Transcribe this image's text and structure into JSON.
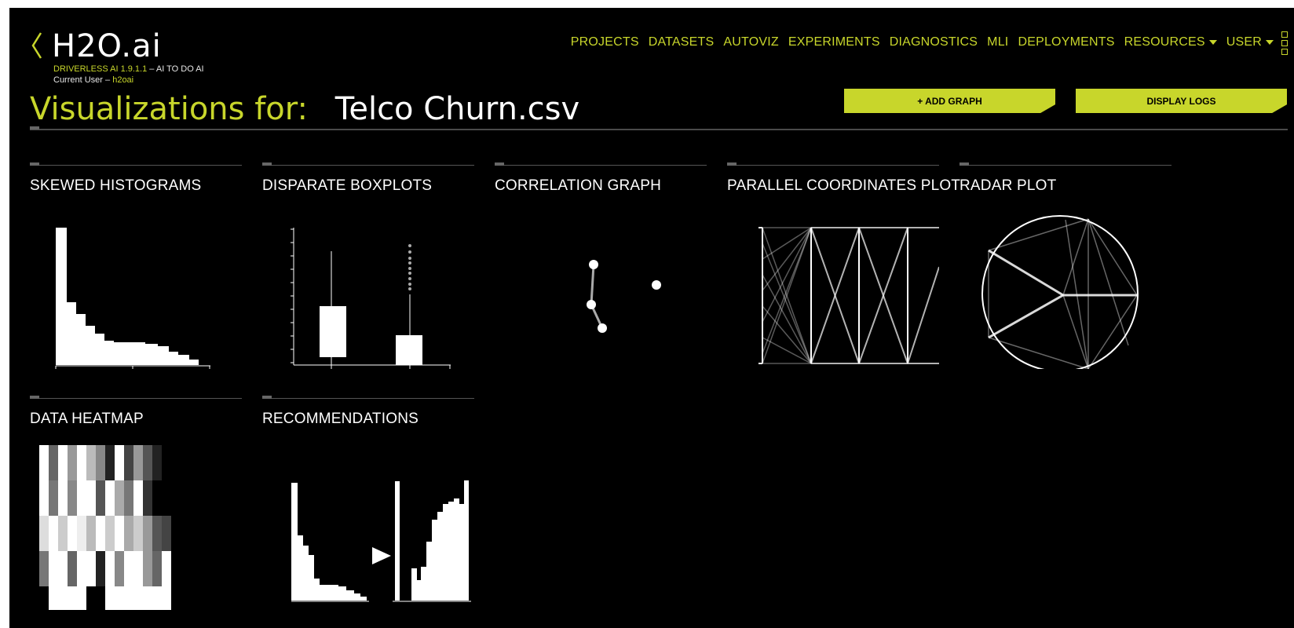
{
  "header": {
    "logo": "H2O.ai",
    "product_version": "DRIVERLESS AI 1.9.1.1",
    "tagline": "AI TO DO AI",
    "separator": "–",
    "current_user_label": "Current User –",
    "current_user": "h2oai"
  },
  "nav": {
    "items": [
      {
        "label": "PROJECTS"
      },
      {
        "label": "DATASETS"
      },
      {
        "label": "AUTOVIZ"
      },
      {
        "label": "EXPERIMENTS"
      },
      {
        "label": "DIAGNOSTICS"
      },
      {
        "label": "MLI"
      },
      {
        "label": "DEPLOYMENTS"
      },
      {
        "label": "RESOURCES",
        "dropdown": true
      },
      {
        "label": "USER",
        "dropdown": true
      }
    ]
  },
  "page": {
    "title_prefix": "Visualizations for:",
    "dataset_name": "Telco Churn.csv",
    "add_graph_label": "+ ADD GRAPH",
    "display_logs_label": "DISPLAY LOGS"
  },
  "cards": [
    {
      "title": "SKEWED HISTOGRAMS",
      "icon": "histogram-thumbnail"
    },
    {
      "title": "DISPARATE BOXPLOTS",
      "icon": "boxplot-thumbnail"
    },
    {
      "title": "CORRELATION GRAPH",
      "icon": "network-graph-thumbnail"
    },
    {
      "title": "PARALLEL COORDINATES PLOT",
      "icon": "parallel-coordinates-thumbnail"
    },
    {
      "title": "RADAR PLOT",
      "icon": "radar-thumbnail"
    },
    {
      "title": "DATA HEATMAP",
      "icon": "heatmap-thumbnail"
    },
    {
      "title": "RECOMMENDATIONS",
      "icon": "recommendations-thumbnail"
    }
  ],
  "colors": {
    "accent": "#c8d62b",
    "background": "#000000",
    "text": "#ffffff"
  }
}
